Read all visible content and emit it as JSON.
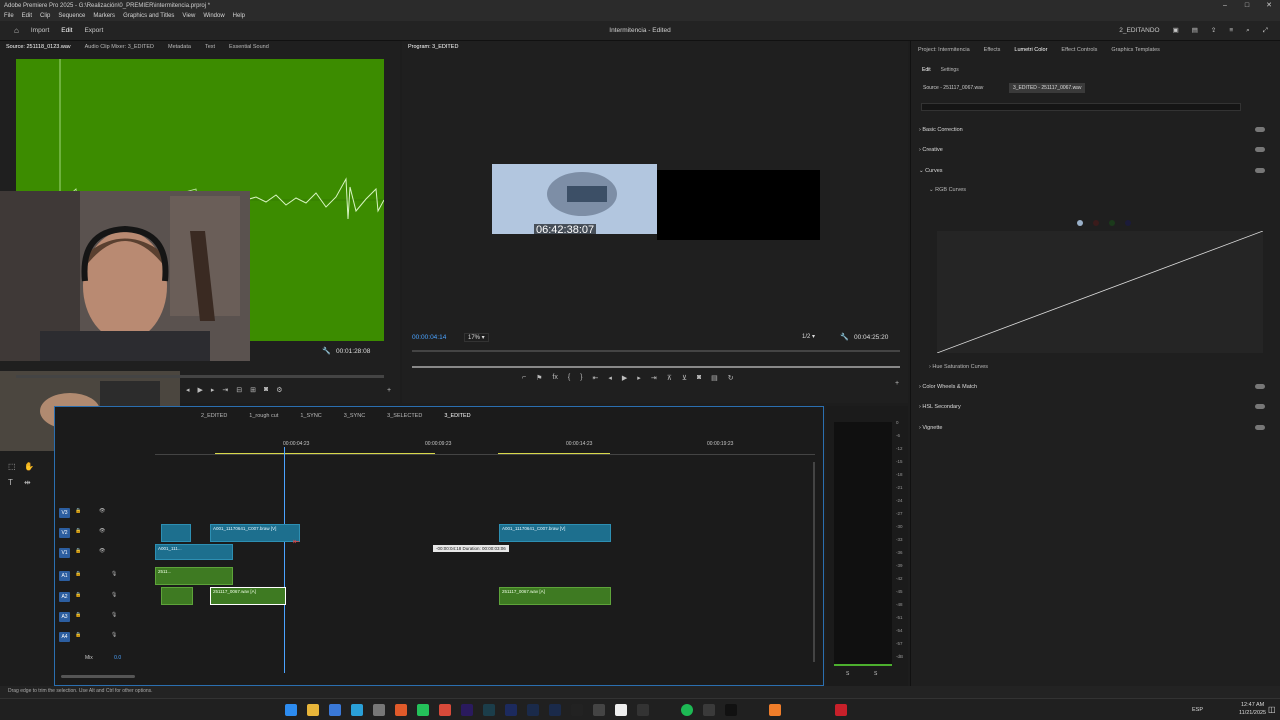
{
  "titlebar": {
    "title": "Adobe Premiere Pro 2025 - G:\\Realización\\0_PREMIER\\intermitencia.prproj *"
  },
  "menu": [
    "File",
    "Edit",
    "Clip",
    "Sequence",
    "Markers",
    "Graphics and Titles",
    "View",
    "Window",
    "Help"
  ],
  "header": {
    "import": "Import",
    "edit": "Edit",
    "export": "Export",
    "project_title": "Intermitencia - Edited",
    "workspace": "2_EDITANDO"
  },
  "source_monitor": {
    "tabs": [
      "Source: 251118_0123.wav",
      "Audio Clip Mixer: 3_EDITED",
      "Metadata",
      "Text",
      "Essential Sound"
    ],
    "timecode": "00:01:28:08"
  },
  "program_monitor": {
    "tab": "Program: 3_EDITED",
    "current_time": "00:00:04:14",
    "zoom": "17%",
    "resolution": "1/2",
    "duration": "00:04:25:20",
    "overlay_timecode": "06:42:38:07"
  },
  "right_panel": {
    "tabs": [
      "Project: Intermitencia",
      "Effects",
      "Lumetri Color",
      "Effect Controls",
      "Graphics Templates"
    ],
    "subtabs": [
      "Edit",
      "Settings"
    ],
    "source_chip": "Source - 251117_0067.wav",
    "active_chip": "3_EDITED - 251117_0067.wav",
    "sections": {
      "basic": "Basic Correction",
      "creative": "Creative",
      "curves": "Curves",
      "rgb": "RGB Curves",
      "hue": "Hue Saturation Curves",
      "wheels": "Color Wheels & Match",
      "hsl": "HSL Secondary",
      "vignette": "Vignette"
    }
  },
  "timeline": {
    "sequence_tabs": [
      "2_EDITED",
      "1_rough cut",
      "1_SYNC",
      "3_SYNC",
      "3_SELECTED",
      "3_EDITED"
    ],
    "ruler": [
      "00:00:04:23",
      "00:00:09:23",
      "00:00:14:23",
      "00:00:19:23"
    ],
    "tracks": [
      "V3",
      "V2",
      "V1",
      "A1",
      "A2",
      "A3",
      "A4"
    ],
    "mix_label": "Mix",
    "mix_value": "0.0",
    "clips": {
      "v2_a": "A001_11170641_C007.braw [V]",
      "v2_b": "A001_11170641_C007.braw [V]",
      "v1_a": "A001_111...",
      "a1_a": "2511...",
      "a2_a": "251117_0067.wav [A]",
      "a2_b": "251117_0067.wav [A]"
    },
    "tooltip": "-00:00:04:18 Duration: 00:00:03:06"
  },
  "meter": {
    "ticks": [
      "0",
      "-6",
      "-12",
      "-15",
      "-18",
      "-21",
      "-24",
      "-27",
      "-30",
      "-33",
      "-36",
      "-39",
      "-42",
      "-45",
      "-48",
      "-51",
      "-54",
      "-57",
      "-dB"
    ],
    "channels": [
      "S",
      "S"
    ]
  },
  "status_bar": {
    "hint": "Drag edge to trim the selection. Use Alt and Ctrl for other options."
  },
  "taskbar": {
    "lang": "ESP",
    "time": "12:47 AM",
    "date": "11/21/2025"
  }
}
